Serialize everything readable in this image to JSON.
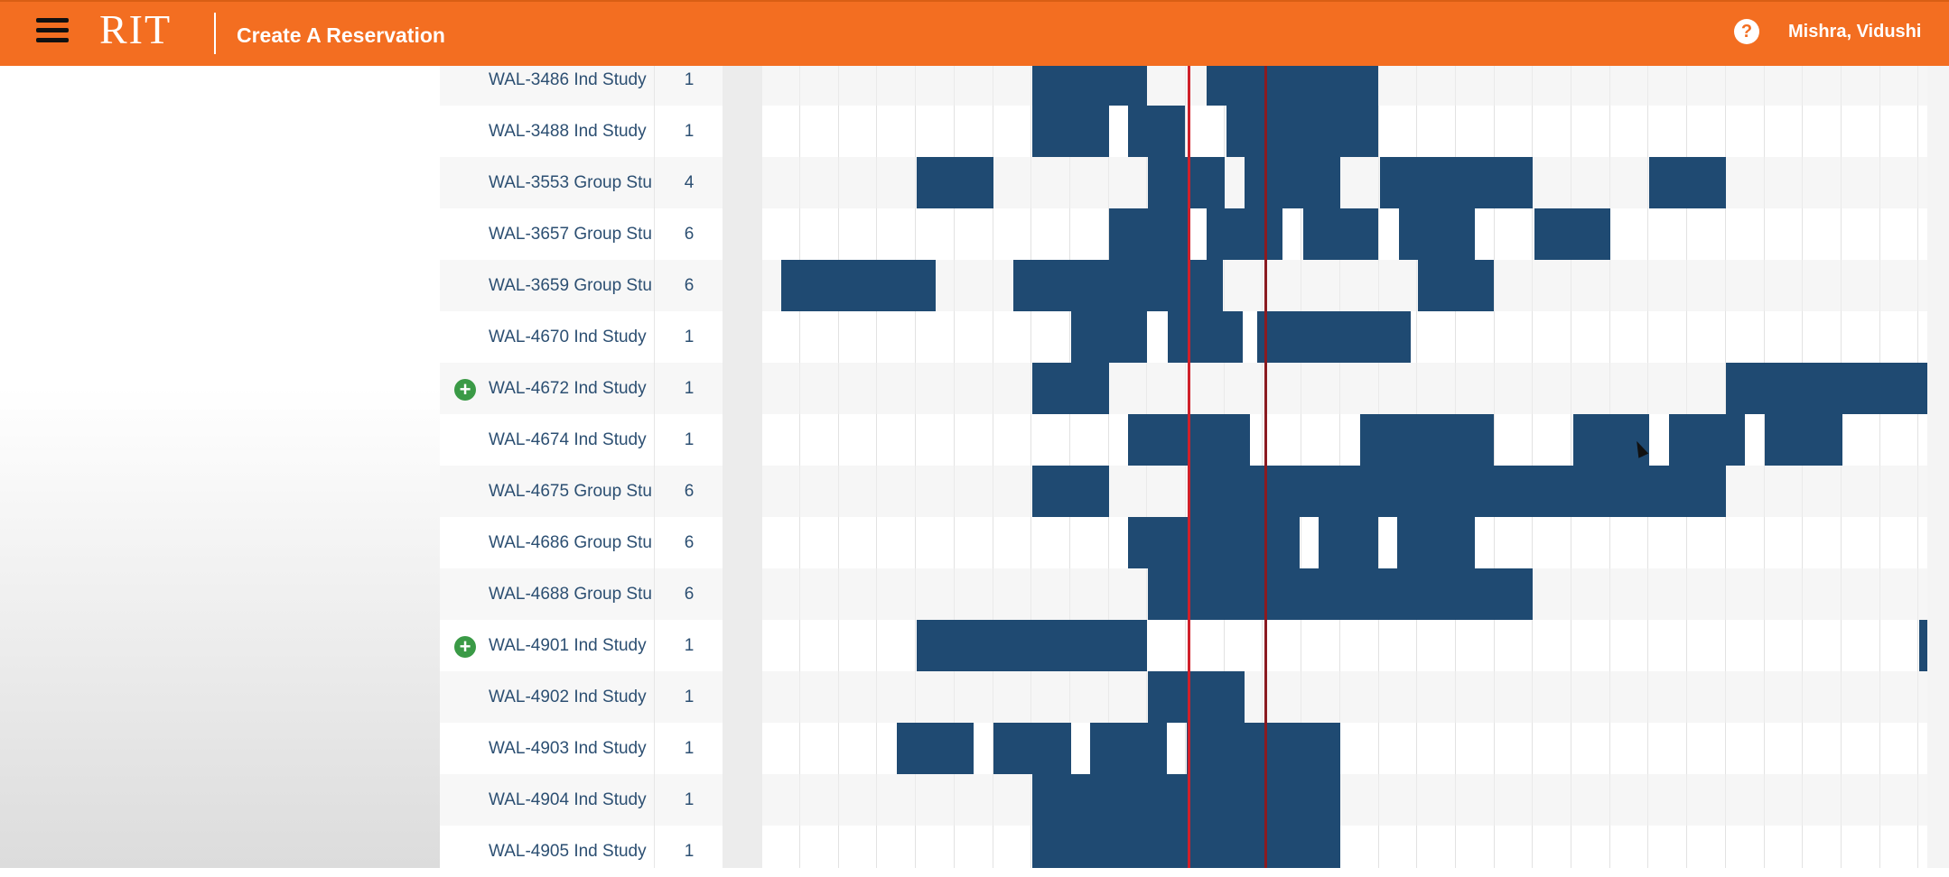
{
  "header": {
    "logo": "RIT",
    "title": "Create A Reservation",
    "help_symbol": "?",
    "user": "Mishra, Vidushi",
    "accent": "#f36e21"
  },
  "colors": {
    "booked": "#1f4a72",
    "now_line": "#d0202a",
    "end_line": "#8a1a20"
  },
  "icons": {
    "menu": "hamburger-icon",
    "help": "help-icon",
    "add": "plus-circle-icon"
  },
  "rooms": [
    {
      "name": "WAL-3486 Ind Study",
      "capacity": "1",
      "add": false
    },
    {
      "name": "WAL-3488 Ind Study",
      "capacity": "1",
      "add": false
    },
    {
      "name": "WAL-3553 Group Stu",
      "capacity": "4",
      "add": false
    },
    {
      "name": "WAL-3657 Group Stu",
      "capacity": "6",
      "add": false
    },
    {
      "name": "WAL-3659 Group Stu",
      "capacity": "6",
      "add": false
    },
    {
      "name": "WAL-4670 Ind Study",
      "capacity": "1",
      "add": false
    },
    {
      "name": "WAL-4672 Ind Study",
      "capacity": "1",
      "add": true
    },
    {
      "name": "WAL-4674 Ind Study",
      "capacity": "1",
      "add": false
    },
    {
      "name": "WAL-4675 Group Stu",
      "capacity": "6",
      "add": false
    },
    {
      "name": "WAL-4686 Group Stu",
      "capacity": "6",
      "add": false
    },
    {
      "name": "WAL-4688 Group Stu",
      "capacity": "6",
      "add": false
    },
    {
      "name": "WAL-4901 Ind Study",
      "capacity": "1",
      "add": true
    },
    {
      "name": "WAL-4902 Ind Study",
      "capacity": "1",
      "add": false
    },
    {
      "name": "WAL-4903 Ind Study",
      "capacity": "1",
      "add": false
    },
    {
      "name": "WAL-4904 Ind Study",
      "capacity": "1",
      "add": false
    },
    {
      "name": "WAL-4905 Ind Study",
      "capacity": "1",
      "add": false
    }
  ]
}
